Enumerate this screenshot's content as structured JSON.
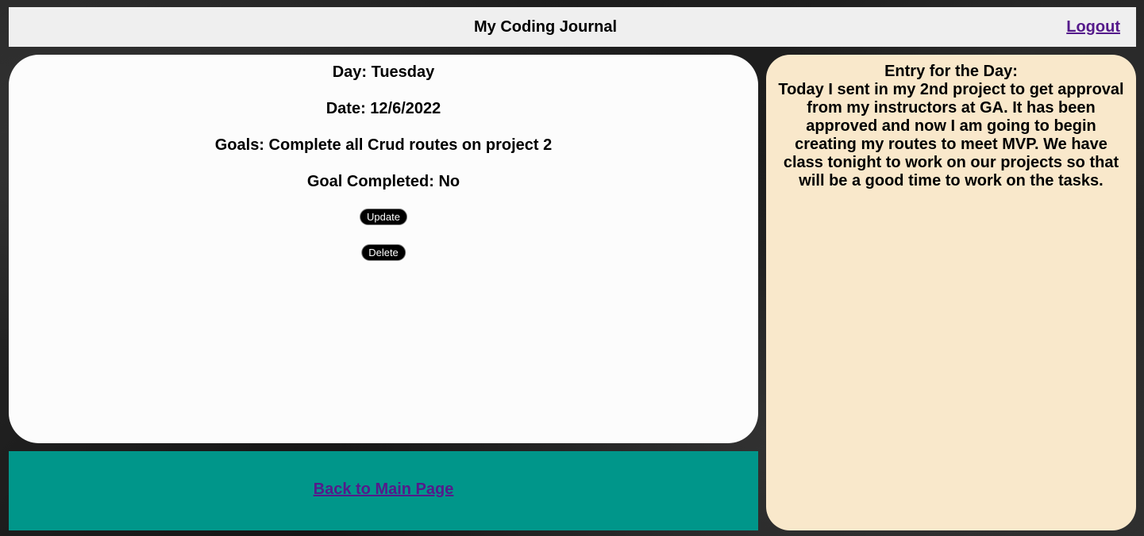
{
  "header": {
    "title": "My Coding Journal",
    "logout_label": "Logout"
  },
  "entry": {
    "day_line": "Day: Tuesday",
    "date_line": "Date: 12/6/2022",
    "goals_line": "Goals: Complete all Crud routes on project 2",
    "completed_line": "Goal Completed: No",
    "update_label": "Update",
    "delete_label": "Delete"
  },
  "footer": {
    "back_label": "Back to Main Page"
  },
  "journal": {
    "heading": "Entry for the Day:",
    "text": "Today I sent in my 2nd project to get approval from my instructors at GA. It has been approved and now I am going to begin creating my routes to meet MVP. We have class tonight to work on our projects so that will be a good time to work on the tasks."
  },
  "colors": {
    "header_bg": "#efefef",
    "card_bg": "#fcfcfc",
    "back_panel_bg": "#00968a",
    "entry_card_bg": "#f9e8cb",
    "link": "#551a8b",
    "button_bg": "#000000"
  }
}
